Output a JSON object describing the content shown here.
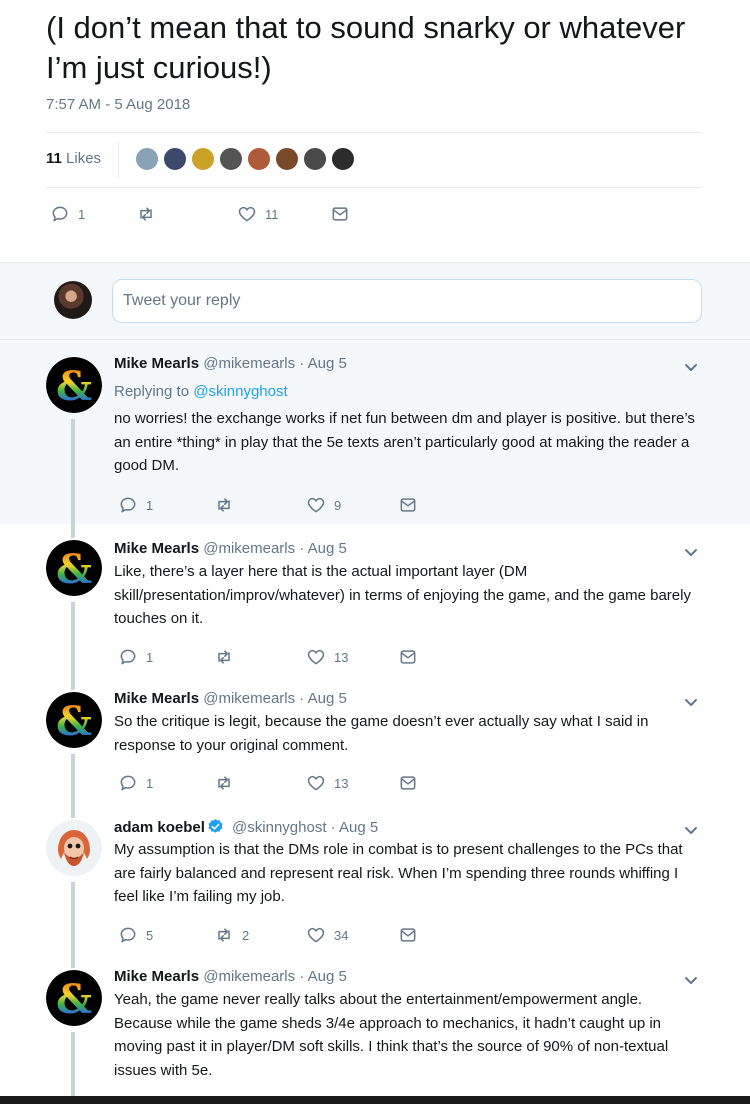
{
  "main_tweet": {
    "text": "(I don’t mean that to sound snarky or whatever I’m just curious!)",
    "timestamp": "7:57 AM - 5 Aug 2018",
    "likes_count": "11",
    "likes_label": "Likes",
    "liker_colors": [
      "#8aa2b5",
      "#3b4a6b",
      "#c9a227",
      "#555555",
      "#b05a3c",
      "#7a4a2a",
      "#4a4a4a",
      "#2c2c2c"
    ],
    "actions": {
      "replies": "1",
      "retweets": "",
      "likes": "11"
    }
  },
  "reply_box": {
    "placeholder": "Tweet your reply"
  },
  "tweets": [
    {
      "name": "Mike Mearls",
      "handle": "@mikemearls",
      "date": "· Aug 5",
      "replying_label": "Replying to",
      "replying_handle": "@skinnyghost",
      "text": "no worries! the exchange works if net fun between dm and player is positive. but there’s an entire *thing* in play that the 5e texts aren’t particularly good at making the reader a good DM.",
      "replies": "1",
      "retweets": "",
      "likes": "9"
    },
    {
      "name": "Mike Mearls",
      "handle": "@mikemearls",
      "date": "· Aug 5",
      "text": "Like, there’s a layer here that is the actual important layer (DM skill/presentation/improv/whatever) in terms of enjoying the game, and the game barely touches on it.",
      "replies": "1",
      "retweets": "",
      "likes": "13"
    },
    {
      "name": "Mike Mearls",
      "handle": "@mikemearls",
      "date": "· Aug 5",
      "text": "So the critique is legit, because the game doesn’t ever actually say what I said in response to your original comment.",
      "replies": "1",
      "retweets": "",
      "likes": "13"
    },
    {
      "name": "adam koebel",
      "handle": "@skinnyghost",
      "date": "· Aug 5",
      "text": "My assumption is that the DMs role in combat is to present challenges to the PCs that are fairly balanced and represent real risk. When I’m spending three rounds whiffing I feel like I’m failing my job.",
      "replies": "5",
      "retweets": "2",
      "likes": "34"
    },
    {
      "name": "Mike Mearls",
      "handle": "@mikemearls",
      "date": "· Aug 5",
      "text": "Yeah, the game never really talks about the entertainment/empowerment angle. Because while the game sheds 3/4e approach to mechanics, it hadn’t caught up in moving past it in player/DM soft skills. I think that’s the source of 90% of non-textual issues with 5e."
    }
  ],
  "colors": {
    "accent": "#1da1f2",
    "muted": "#657786",
    "text": "#14171a",
    "thread": "#c8d2d9",
    "focus_bg": "#f5f8fa"
  }
}
